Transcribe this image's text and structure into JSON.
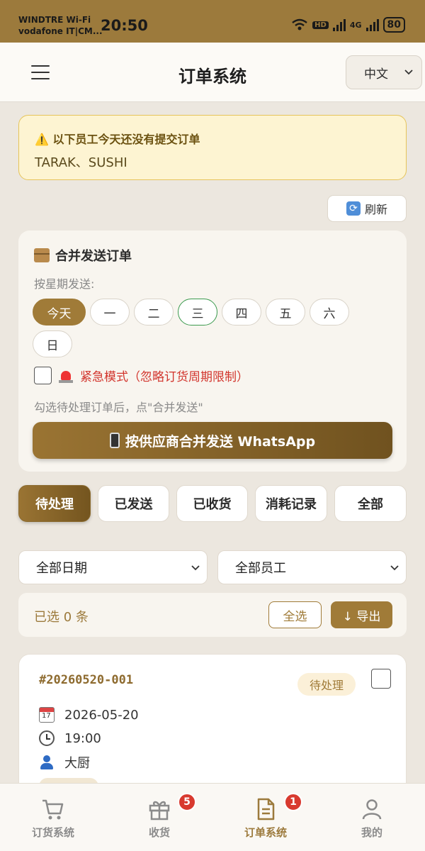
{
  "status_bar": {
    "carrier_1": "WINDTRE Wi-Fi",
    "carrier_2": "vodafone IT|CM...",
    "time": "20:50",
    "network": "4G",
    "hd": "HD",
    "battery": "80"
  },
  "header": {
    "title": "订单系统",
    "language": "中文"
  },
  "warning": {
    "title": "⚠️ 以下员工今天还没有提交订单",
    "names": "TARAK、SUSHI"
  },
  "refresh_label": "刷新",
  "merge": {
    "title": "合并发送订单",
    "weekday_label": "按星期发送:",
    "days": [
      "今天",
      "一",
      "二",
      "三",
      "四",
      "五",
      "六",
      "日"
    ],
    "urgent_label": "紧急模式（忽略订货周期限制）",
    "hint": "勾选待处理订单后，点\"合并发送\"",
    "send_button": "按供应商合并发送 WhatsApp"
  },
  "tabs": [
    "待处理",
    "已发送",
    "已收货",
    "消耗记录",
    "全部"
  ],
  "filters": {
    "date": "全部日期",
    "staff": "全部员工"
  },
  "selection": {
    "count_text": "已选 0 条",
    "select_all": "全选",
    "export": "↓ 导出"
  },
  "order": {
    "id": "#20260520-001",
    "status": "待处理",
    "date": "2026-05-20",
    "time": "19:00",
    "person": "大厨"
  },
  "bottom_nav": [
    {
      "label": "订货系统",
      "icon": "cart-icon"
    },
    {
      "label": "收货",
      "icon": "gift-icon",
      "badge": "5"
    },
    {
      "label": "订单系统",
      "icon": "document-icon",
      "badge": "1"
    },
    {
      "label": "我的",
      "icon": "user-icon"
    }
  ],
  "colors": {
    "accent": "#9c7a3c",
    "danger": "#d2342c",
    "warning_bg": "#fdf4d2"
  }
}
